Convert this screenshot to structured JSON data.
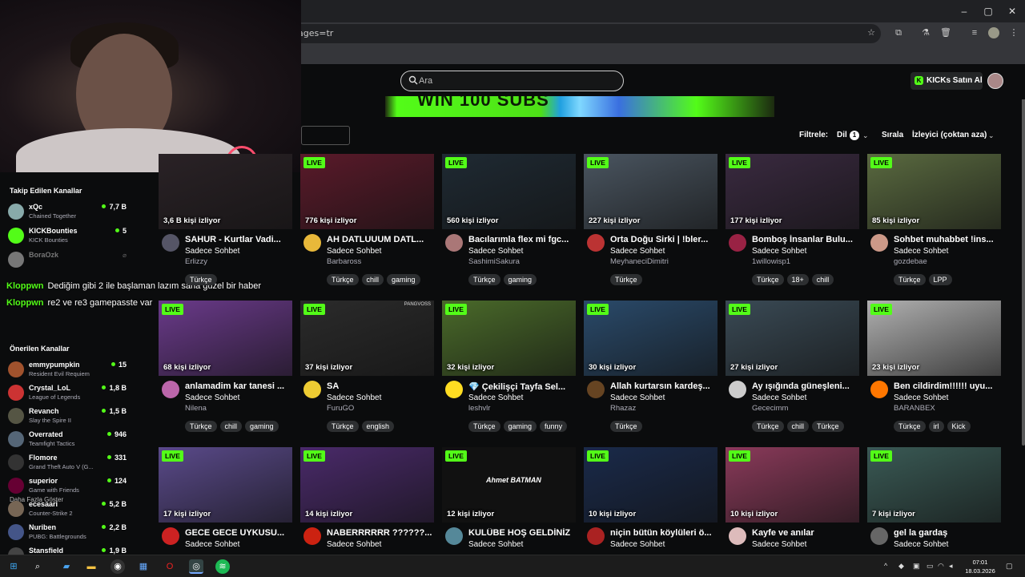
{
  "browser": {
    "url_tail": "ages=tr",
    "window_controls": {
      "minimize": "–",
      "maximize": "▢",
      "close": "✕"
    },
    "toolbar_icons": [
      "star-icon",
      "extensions-icon",
      "flask-icon",
      "trash-icon",
      "playlist-icon",
      "profile-icon",
      "menu-icon"
    ]
  },
  "header": {
    "search_placeholder": "Ara",
    "buy_kicks": "KICKs Satın Al",
    "brand_green": "#53fc18"
  },
  "banner": {
    "text": "WIN 100 SUBS"
  },
  "filters": {
    "filter_label": "Filtrele:",
    "language_label": "Dil",
    "language_count": "1",
    "sort_label": "Sırala",
    "sort_value": "İzleyici (çoktan aza)"
  },
  "sidebar": {
    "followed_title": "Takip Edilen Kanallar",
    "followed": [
      {
        "name": "xQc",
        "category": "Chained Together",
        "viewers": "7,7 B",
        "live": true,
        "color": "#8aa"
      },
      {
        "name": "KICKBounties",
        "category": "KICK Bounties",
        "viewers": "5",
        "live": true,
        "color": "#53fc18"
      },
      {
        "name": "BoraOzk",
        "category": "",
        "viewers": "",
        "live": false,
        "color": "#777"
      }
    ],
    "show_more": "Daha Fazla Göster",
    "recommended_title": "Önerilen Kanallar",
    "recommended": [
      {
        "name": "emmypumpkin",
        "category": "Resident Evil Requiem",
        "viewers": "15",
        "color": "#a0522d"
      },
      {
        "name": "Crystal_LoL",
        "category": "League of Legends",
        "viewers": "1,8 B",
        "color": "#c33"
      },
      {
        "name": "Revanch",
        "category": "Slay the Spire II",
        "viewers": "1,5 B",
        "color": "#554"
      },
      {
        "name": "Overrated",
        "category": "Teamfight Tactics",
        "viewers": "946",
        "color": "#567"
      },
      {
        "name": "Flomore",
        "category": "Grand Theft Auto V (G...",
        "viewers": "331",
        "color": "#333"
      },
      {
        "name": "superior",
        "category": "Game with Friends",
        "viewers": "124",
        "color": "#603"
      },
      {
        "name": "ecesaari",
        "category": "Counter-Strike 2",
        "viewers": "5,2 B",
        "color": "#765"
      },
      {
        "name": "Nuriben",
        "category": "PUBG: Battlegrounds",
        "viewers": "2,2 B",
        "color": "#458"
      },
      {
        "name": "Stansfield",
        "category": "",
        "viewers": "1,9 B",
        "color": "#444"
      }
    ]
  },
  "chat_overlay": [
    {
      "user": "Kloppwn",
      "message": "Dediğim gibi 2 ile başlaman lazım sana güzel bir haber"
    },
    {
      "user": "Kloppwn",
      "message": "re2 ve re3 gamepasste var"
    }
  ],
  "streams": [
    {
      "live": "",
      "viewers": "3,6 B kişi izliyor",
      "title": "SAHUR - Kurtlar Vadi...",
      "category": "Sadece Sohbet",
      "channel": "Erlizzy",
      "tags": [
        "Türkçe"
      ],
      "thumb": "#2a2226",
      "avatar": "#556"
    },
    {
      "live": "LIVE",
      "viewers": "776 kişi izliyor",
      "title": "AH DATLUUUM DATL...",
      "category": "Sadece Sohbet",
      "channel": "Barbaross",
      "tags": [
        "Türkçe",
        "chill",
        "gaming"
      ],
      "thumb": "#5a1a2a",
      "avatar": "#e8b83a"
    },
    {
      "live": "LIVE",
      "viewers": "560 kişi izliyor",
      "title": "Bacılarımla flex mi fgc...",
      "category": "Sadece Sohbet",
      "channel": "SashimiSakura",
      "tags": [
        "Türkçe",
        "gaming"
      ],
      "thumb": "#1f2a33",
      "avatar": "#a77"
    },
    {
      "live": "LIVE",
      "viewers": "227 kişi izliyor",
      "title": "Orta Doğu Sirki | !bler...",
      "category": "Sadece Sohbet",
      "channel": "MeyhaneciDimitri",
      "tags": [
        "Türkçe"
      ],
      "thumb": "#4a5560",
      "avatar": "#b33"
    },
    {
      "live": "LIVE",
      "viewers": "177 kişi izliyor",
      "title": "Bomboş İnsanlar Bulu...",
      "category": "Sadece Sohbet",
      "channel": "1willowisp1",
      "tags": [
        "Türkçe",
        "18+",
        "chill"
      ],
      "thumb": "#3a2a40",
      "avatar": "#924"
    },
    {
      "live": "LIVE",
      "viewers": "85 kişi izliyor",
      "title": "Sohbet muhabbet !ins...",
      "category": "Sadece Sohbet",
      "channel": "gozdebae",
      "tags": [
        "Türkçe",
        "LPP"
      ],
      "thumb": "#5a6a40",
      "avatar": "#c98"
    },
    {
      "live": "LIVE",
      "viewers": "68 kişi izliyor",
      "title": "anlamadim kar tanesi ...",
      "category": "Sadece Sohbet",
      "channel": "Nilena",
      "tags": [
        "Türkçe",
        "chill",
        "gaming"
      ],
      "thumb": "#6a3a8a",
      "avatar": "#b6a"
    },
    {
      "live": "LIVE",
      "viewers": "37 kişi izliyor",
      "title": "SA",
      "category": "Sadece Sohbet",
      "channel": "FuruGO",
      "tags": [
        "Türkçe",
        "english"
      ],
      "thumb": "#2b2b2b",
      "avatar": "#ec3"
    },
    {
      "live": "LIVE",
      "viewers": "32 kişi izliyor",
      "title": "💎 Çekilişçi Tayfa Sel...",
      "category": "Sadece Sohbet",
      "channel": "leshvlr",
      "tags": [
        "Türkçe",
        "gaming",
        "funny"
      ],
      "thumb": "#4a6a2a",
      "avatar": "#fd2"
    },
    {
      "live": "LIVE",
      "viewers": "30 kişi izliyor",
      "title": "Allah kurtarsın kardeş...",
      "category": "Sadece Sohbet",
      "channel": "Rhazaz",
      "tags": [
        "Türkçe"
      ],
      "thumb": "#2a4a6a",
      "avatar": "#642"
    },
    {
      "live": "LIVE",
      "viewers": "27 kişi izliyor",
      "title": "Ay ışığında güneşleni...",
      "category": "Sadece Sohbet",
      "channel": "Gececimm",
      "tags": [
        "Türkçe",
        "chill",
        "Türkçe"
      ],
      "thumb": "#3a4a55",
      "avatar": "#ccc"
    },
    {
      "live": "LIVE",
      "viewers": "23 kişi izliyor",
      "title": "Ben cildirdim!!!!!! uyu...",
      "category": "Sadece Sohbet",
      "channel": "BARANBEX",
      "tags": [
        "Türkçe",
        "irl",
        "Kick"
      ],
      "thumb": "#b0b0b0",
      "avatar": "#f70"
    },
    {
      "live": "LIVE",
      "viewers": "17 kişi izliyor",
      "title": "GECE GECE UYKUSU...",
      "category": "Sadece Sohbet",
      "channel": "",
      "tags": [],
      "thumb": "#5a4a8a",
      "avatar": "#c22"
    },
    {
      "live": "LIVE",
      "viewers": "14 kişi izliyor",
      "title": "NABERRRRRR ??????...",
      "category": "Sadece Sohbet",
      "channel": "",
      "tags": [],
      "thumb": "#4a2a6a",
      "avatar": "#c21"
    },
    {
      "live": "LIVE",
      "viewers": "12 kişi izliyor",
      "title": "KULÜBE HOŞ GELDİNİZ",
      "category": "Sadece Sohbet",
      "channel": "",
      "tags": [],
      "thumb": "#111111",
      "avatar": "#589"
    },
    {
      "live": "LIVE",
      "viewers": "10 kişi izliyor",
      "title": "niçin bütün köylüleri ö...",
      "category": "Sadece Sohbet",
      "channel": "",
      "tags": [],
      "thumb": "#1a2a4a",
      "avatar": "#a22"
    },
    {
      "live": "LIVE",
      "viewers": "10 kişi izliyor",
      "title": "Kayfe ve anılar",
      "category": "Sadece Sohbet",
      "channel": "",
      "tags": [],
      "thumb": "#8a3a5a",
      "avatar": "#dbb"
    },
    {
      "live": "LIVE",
      "viewers": "7 kişi izliyor",
      "title": "gel la gardaş",
      "category": "Sadece Sohbet",
      "channel": "",
      "tags": [],
      "thumb": "#3a5a55",
      "avatar": "#666"
    }
  ],
  "thumb_labels": {
    "s1": "PANGVOSS",
    "s2": "Ahmet BATMAN"
  },
  "taskbar": {
    "time": "07:01",
    "date": "18.03.2026"
  }
}
